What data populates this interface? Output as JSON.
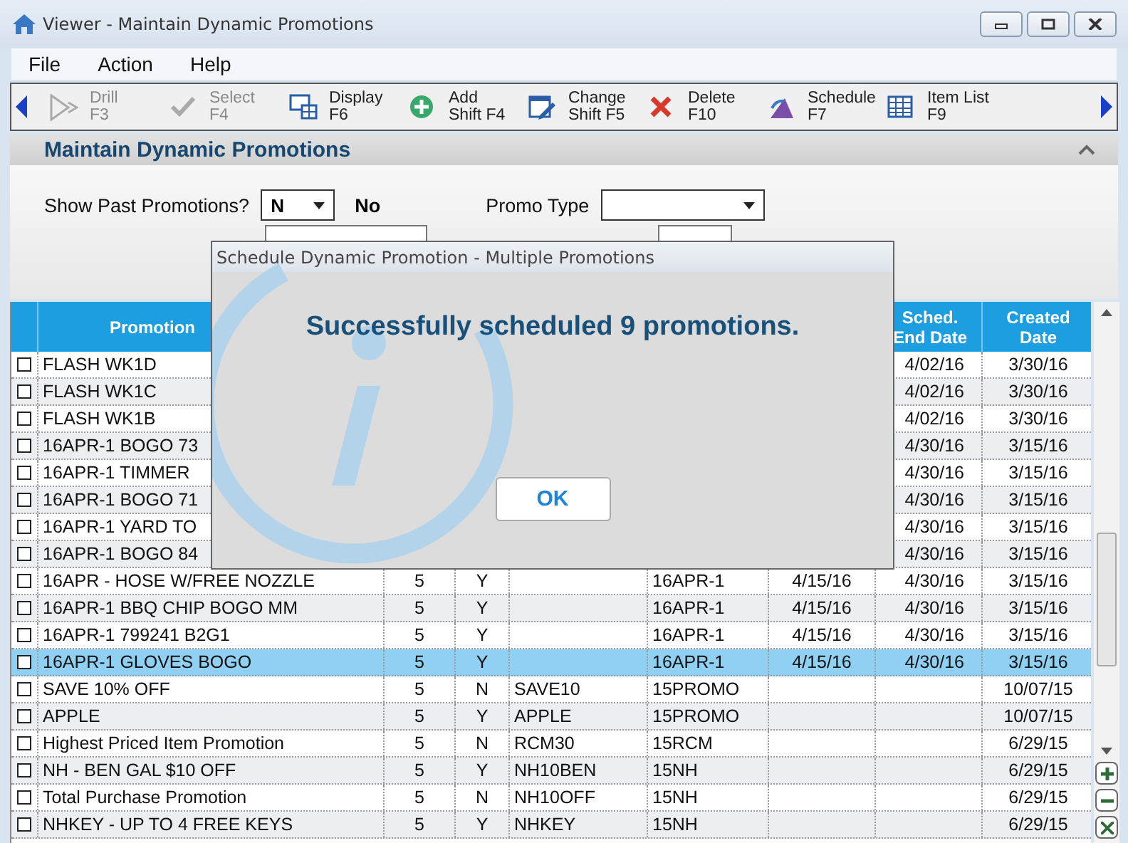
{
  "window": {
    "title": "Viewer - Maintain Dynamic Promotions"
  },
  "menu": [
    "File",
    "Action",
    "Help"
  ],
  "toolbar": [
    {
      "kind": "drill",
      "label": "Drill",
      "key": "F3",
      "disabled": true
    },
    {
      "kind": "select",
      "label": "Select",
      "key": "F4",
      "disabled": true
    },
    {
      "kind": "display",
      "label": "Display",
      "key": "F6",
      "disabled": false
    },
    {
      "kind": "add",
      "label": "Add",
      "key": "Shift F4",
      "disabled": false
    },
    {
      "kind": "change",
      "label": "Change",
      "key": "Shift F5",
      "disabled": false
    },
    {
      "kind": "delete",
      "label": "Delete",
      "key": "F10",
      "disabled": false
    },
    {
      "kind": "schedule",
      "label": "Schedule",
      "key": "F7",
      "disabled": false
    },
    {
      "kind": "itemlist",
      "label": "Item List",
      "key": "F9",
      "disabled": false
    }
  ],
  "section": {
    "title": "Maintain Dynamic Promotions",
    "expanded": true
  },
  "filters": {
    "show_past_label": "Show Past Promotions?",
    "show_past_value": "N",
    "show_past_text": "No",
    "promo_type_label": "Promo Type"
  },
  "table": {
    "headers": {
      "name": "Promotion",
      "end_date": "Sched. End Date",
      "created": "Created Date"
    },
    "rows": [
      {
        "checked": false,
        "selected": false,
        "name": "FLASH WK1D",
        "end_date": "4/02/16",
        "created": "3/30/16"
      },
      {
        "checked": false,
        "selected": false,
        "name": "FLASH WK1C",
        "end_date": "4/02/16",
        "created": "3/30/16"
      },
      {
        "checked": false,
        "selected": false,
        "name": "FLASH WK1B",
        "end_date": "4/02/16",
        "created": "3/30/16"
      },
      {
        "checked": false,
        "selected": false,
        "name": "16APR-1 BOGO 73",
        "end_date": "4/30/16",
        "created": "3/15/16"
      },
      {
        "checked": false,
        "selected": false,
        "name": "16APR-1 TIMMER",
        "end_date": "4/30/16",
        "created": "3/15/16"
      },
      {
        "checked": false,
        "selected": false,
        "name": "16APR-1 BOGO 71",
        "end_date": "4/30/16",
        "created": "3/15/16"
      },
      {
        "checked": false,
        "selected": false,
        "name": "16APR-1 YARD TO",
        "end_date": "4/30/16",
        "created": "3/15/16"
      },
      {
        "checked": false,
        "selected": false,
        "name": "16APR-1 BOGO 84",
        "end_date": "4/30/16",
        "created": "3/15/16"
      },
      {
        "checked": false,
        "selected": false,
        "name": "16APR - HOSE W/FREE NOZZLE",
        "column_3": "5",
        "column_4": "Y",
        "column_6": "16APR-1",
        "column_7": "4/15/16",
        "end_date": "4/30/16",
        "created": "3/15/16"
      },
      {
        "checked": false,
        "selected": false,
        "name": "16APR-1 BBQ CHIP BOGO MM",
        "column_3": "5",
        "column_4": "Y",
        "column_6": "16APR-1",
        "column_7": "4/15/16",
        "end_date": "4/30/16",
        "created": "3/15/16"
      },
      {
        "checked": false,
        "selected": false,
        "name": "16APR-1 799241 B2G1",
        "column_3": "5",
        "column_4": "Y",
        "column_6": "16APR-1",
        "column_7": "4/15/16",
        "end_date": "4/30/16",
        "created": "3/15/16"
      },
      {
        "checked": false,
        "selected": true,
        "name": "16APR-1 GLOVES BOGO",
        "column_3": "5",
        "column_4": "Y",
        "column_6": "16APR-1",
        "column_7": "4/15/16",
        "end_date": "4/30/16",
        "created": "3/15/16"
      },
      {
        "checked": false,
        "selected": false,
        "name": "SAVE 10% OFF",
        "column_3": "5",
        "column_4": "N",
        "column_5": "SAVE10",
        "column_6": "15PROMO",
        "created": "10/07/15"
      },
      {
        "checked": false,
        "selected": false,
        "name": "APPLE",
        "column_3": "5",
        "column_4": "Y",
        "column_5": "APPLE",
        "column_6": "15PROMO",
        "created": "10/07/15"
      },
      {
        "checked": false,
        "selected": false,
        "name": "Highest Priced Item Promotion",
        "column_3": "5",
        "column_4": "N",
        "column_5": "RCM30",
        "column_6": "15RCM",
        "created": "6/29/15"
      },
      {
        "checked": false,
        "selected": false,
        "name": "NH - BEN GAL $10 OFF",
        "column_3": "5",
        "column_4": "Y",
        "column_5": "NH10BEN",
        "column_6": "15NH",
        "created": "6/29/15"
      },
      {
        "checked": false,
        "selected": false,
        "name": "Total Purchase Promotion",
        "column_3": "5",
        "column_4": "N",
        "column_5": "NH10OFF",
        "column_6": "15NH",
        "created": "6/29/15"
      },
      {
        "checked": false,
        "selected": false,
        "name": "NHKEY - UP TO 4 FREE KEYS",
        "column_3": "5",
        "column_4": "Y",
        "column_5": "NHKEY",
        "column_6": "15NH",
        "created": "6/29/15"
      }
    ]
  },
  "dialog": {
    "title": "Schedule Dynamic Promotion - Multiple Promotions",
    "message": "Successfully scheduled 9 promotions.",
    "button": "OK"
  }
}
